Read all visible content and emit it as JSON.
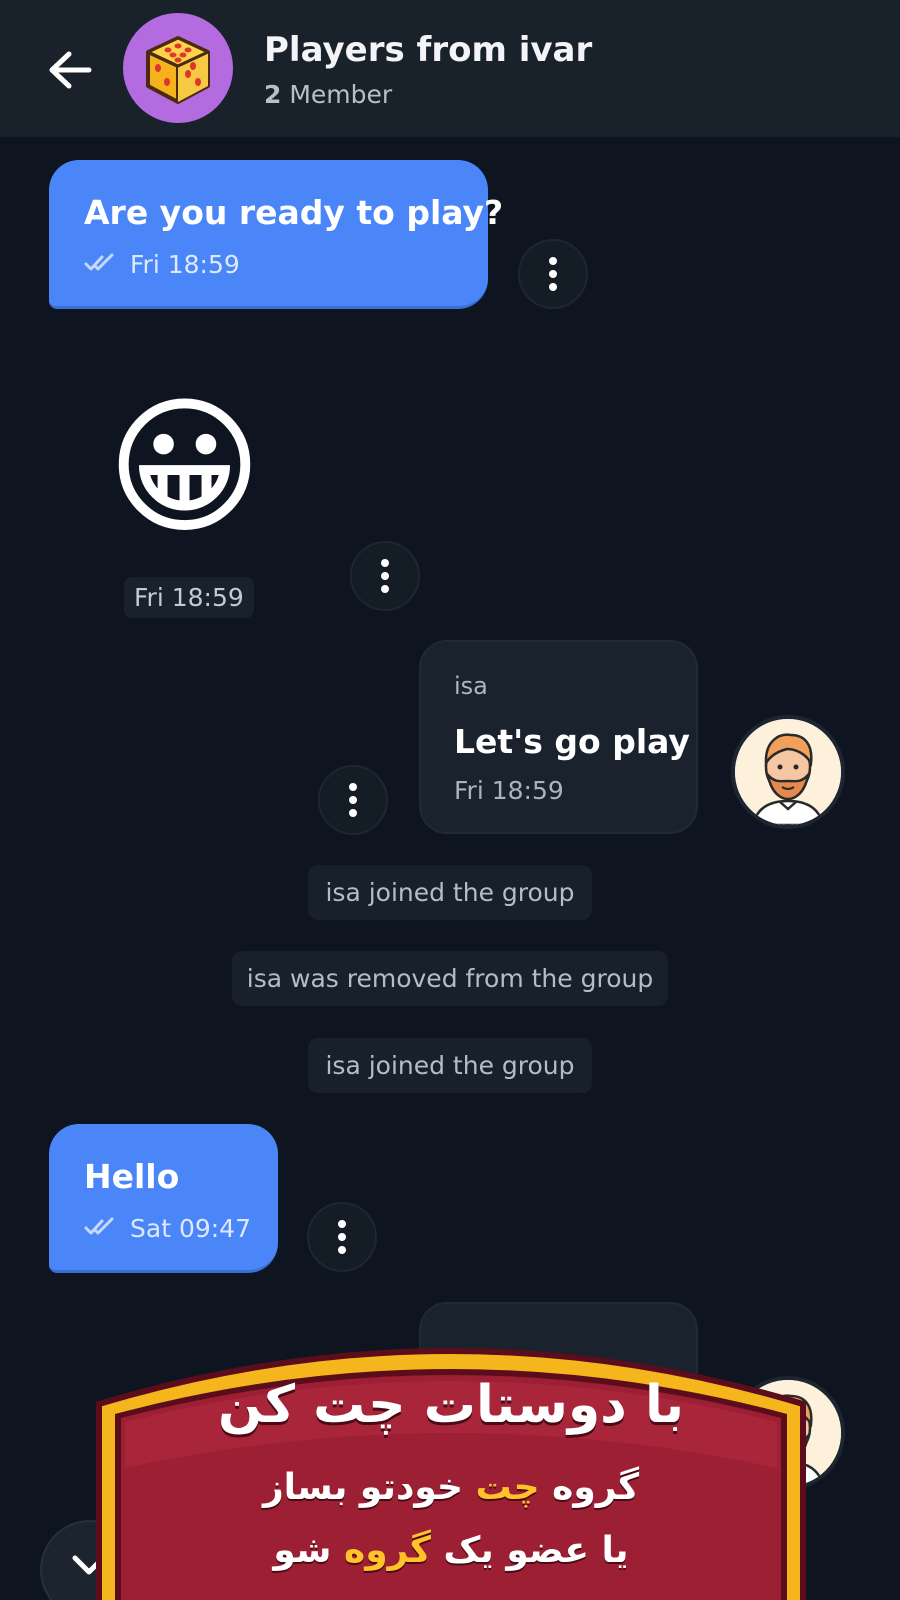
{
  "header": {
    "title": "Players from ivar",
    "member_count": "2",
    "member_label": "Member"
  },
  "messages": [
    {
      "type": "outgoing",
      "text": "Are you ready to play?",
      "time": "Fri 18:59"
    },
    {
      "type": "outgoing-emoji",
      "emoji": "😀",
      "time": "Fri 18:59"
    },
    {
      "type": "incoming",
      "sender": "isa",
      "text": "Let's go play",
      "time": "Fri 18:59"
    },
    {
      "type": "system",
      "text": "isa joined the group"
    },
    {
      "type": "system",
      "text": "isa was removed from the group"
    },
    {
      "type": "system",
      "text": "isa joined the group"
    },
    {
      "type": "outgoing",
      "text": "Hello",
      "time": "Sat 09:47"
    }
  ],
  "banner": {
    "line1": "با دوستات چت کن",
    "line2_a": "گروه ",
    "line2_hl": "چت",
    "line2_b": " خودتو بساز",
    "line3_a": "یا عضو یک ",
    "line3_hl": "گروه",
    "line3_b": " شو"
  },
  "colors": {
    "background": "#0f1520",
    "outgoing_bubble": "#4a86f7",
    "incoming_bubble": "#19222d",
    "banner_red": "#9c1f33",
    "banner_gold": "#f5b51d",
    "highlight": "#ffc22b"
  },
  "icons": [
    "back-arrow-icon",
    "dice-icon",
    "double-check-icon",
    "more-vertical-icon",
    "chevron-down-icon"
  ]
}
